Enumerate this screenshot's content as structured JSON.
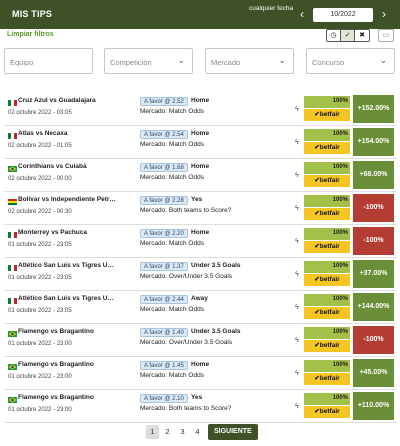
{
  "header": {
    "title": "MIS TIPS",
    "date_hint": "cualquier fecha",
    "month": "10/2022",
    "prev_icon": "chevron-left-icon",
    "next_icon": "chevron-right-icon"
  },
  "filters": {
    "clear_label": "Limpiar filtros",
    "buttons": [
      "◷",
      "✓",
      "✖"
    ],
    "chat_icon": "chat-icon"
  },
  "dropdowns": [
    {
      "placeholder": "Equipo"
    },
    {
      "placeholder": "Competición"
    },
    {
      "placeholder": "Mercado"
    },
    {
      "placeholder": "Concurso"
    }
  ],
  "colors": {
    "brand": "#3f5227",
    "win": "#6a8f38",
    "loss": "#b33d32",
    "betfair": "#f5c623",
    "percent_bar": "#a2c04a"
  },
  "tips": [
    {
      "flag": "mx",
      "match": "Cruz Azul vs Guadalajara",
      "date": "02 octubre 2022 - 03:05",
      "favor": "A favor @ 2.52",
      "selection": "Home",
      "market": "Mercado: Match Odds",
      "percent": "100%",
      "provider": "✔betfair",
      "profit": "+152.00%",
      "result": "win"
    },
    {
      "flag": "mx",
      "match": "Atlas vs Necaxa",
      "date": "02 octubre 2022 - 01:05",
      "favor": "A favor @ 2.54",
      "selection": "Home",
      "market": "Mercado: Match Odds",
      "percent": "100%",
      "provider": "✔betfair",
      "profit": "+154.00%",
      "result": "win"
    },
    {
      "flag": "br",
      "match": "Corinthians vs Cuiabá",
      "date": "02 octubre 2022 - 00:00",
      "favor": "A favor @ 1.68",
      "selection": "Home",
      "market": "Mercado: Match Odds",
      "percent": "100%",
      "provider": "✔betfair",
      "profit": "+68.00%",
      "result": "win"
    },
    {
      "flag": "bo",
      "match": "Bolivar vs Independiente Petr…",
      "date": "02 octubre 2022 - 00:30",
      "favor": "A favor @ 2.28",
      "selection": "Yes",
      "market": "Mercado: Both teams to Score?",
      "percent": "100%",
      "provider": "✔betfair",
      "profit": "-100%",
      "result": "loss"
    },
    {
      "flag": "mx",
      "match": "Monterrey vs Pachuca",
      "date": "01 octubre 2022 - 23:05",
      "favor": "A favor @ 2.20",
      "selection": "Home",
      "market": "Mercado: Match Odds",
      "percent": "100%",
      "provider": "✔betfair",
      "profit": "-100%",
      "result": "loss"
    },
    {
      "flag": "mx",
      "match": "Atlético San Luis vs Tigres U…",
      "date": "01 octubre 2022 - 23:05",
      "favor": "A favor @ 1.37",
      "selection": "Under 3.5 Goals",
      "market": "Mercado: Over/Under 3.5 Goals",
      "percent": "100%",
      "provider": "✔betfair",
      "profit": "+37.00%",
      "result": "win"
    },
    {
      "flag": "mx",
      "match": "Atlético San Luis vs Tigres U…",
      "date": "01 octubre 2022 - 23:05",
      "favor": "A favor @ 2.44",
      "selection": "Away",
      "market": "Mercado: Match Odds",
      "percent": "100%",
      "provider": "✔betfair",
      "profit": "+144.00%",
      "result": "win"
    },
    {
      "flag": "br",
      "match": "Flamengo vs Bragantino",
      "date": "01 octubre 2022 - 23:00",
      "favor": "A favor @ 1.40",
      "selection": "Under 3.5 Goals",
      "market": "Mercado: Over/Under 3.5 Goals",
      "percent": "100%",
      "provider": "✔betfair",
      "profit": "-100%",
      "result": "loss"
    },
    {
      "flag": "br",
      "match": "Flamengo vs Bragantino",
      "date": "01 octubre 2022 - 23:00",
      "favor": "A favor @ 1.45",
      "selection": "Home",
      "market": "Mercado: Match Odds",
      "percent": "100%",
      "provider": "✔betfair",
      "profit": "+45.00%",
      "result": "win"
    },
    {
      "flag": "br",
      "match": "Flamengo vs Bragantino",
      "date": "01 octubre 2022 - 23:00",
      "favor": "A favor @ 2.10",
      "selection": "Yes",
      "market": "Mercado: Both teams to Score?",
      "percent": "100%",
      "provider": "✔betfair",
      "profit": "+110.00%",
      "result": "win"
    }
  ],
  "pagination": {
    "pages": [
      "1",
      "2",
      "3",
      "4"
    ],
    "current": "1",
    "next_label": "SIGUIENTE"
  }
}
